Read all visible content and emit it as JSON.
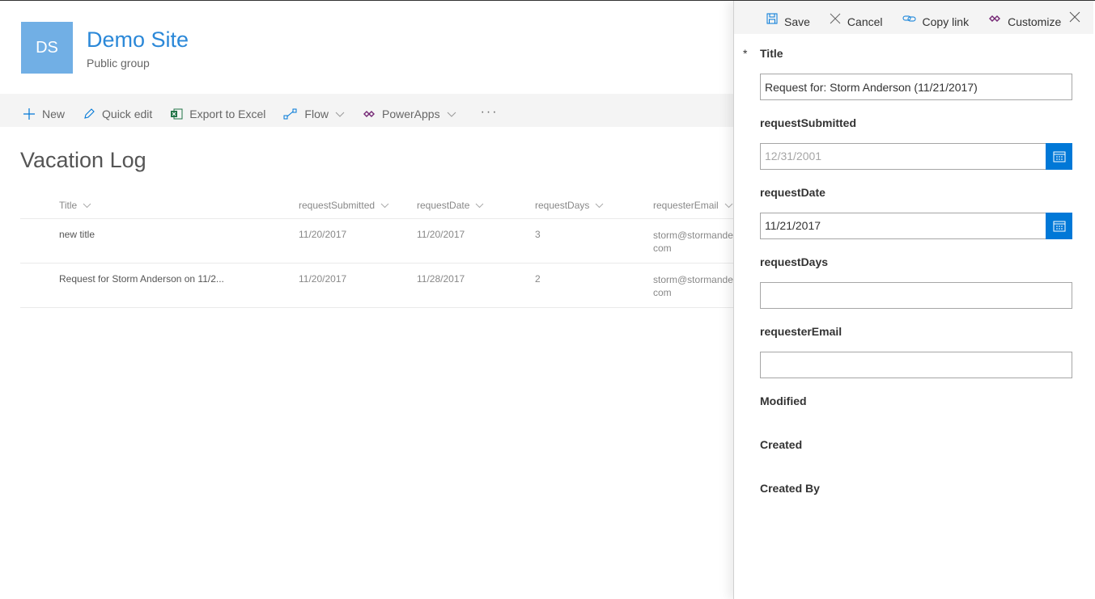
{
  "site": {
    "logo_initials": "DS",
    "title": "Demo Site",
    "subtitle": "Public group"
  },
  "commands": {
    "new": "New",
    "quick_edit": "Quick edit",
    "export": "Export to Excel",
    "flow": "Flow",
    "powerapps": "PowerApps",
    "more": "···"
  },
  "list": {
    "title": "Vacation Log",
    "columns": [
      "Title",
      "requestSubmitted",
      "requestDate",
      "requestDays",
      "requesterEmail"
    ],
    "rows": [
      {
        "title": "new title",
        "requestSubmitted": "11/20/2017",
        "requestDate": "11/20/2017",
        "requestDays": "3",
        "requesterEmail": "storm@stormande com"
      },
      {
        "title": "Request for Storm Anderson on 11/2...",
        "requestSubmitted": "11/20/2017",
        "requestDate": "11/28/2017",
        "requestDays": "2",
        "requesterEmail": "storm@stormande com"
      }
    ]
  },
  "panel": {
    "commands": {
      "save": "Save",
      "cancel": "Cancel",
      "copy_link": "Copy link",
      "customize": "Customize"
    },
    "fields": {
      "title_label": "Title",
      "required_marker": "*",
      "title_value": "Request for: Storm Anderson (11/21/2017)",
      "requestSubmitted_label": "requestSubmitted",
      "requestSubmitted_placeholder": "12/31/2001",
      "requestDate_label": "requestDate",
      "requestDate_value": "11/21/2017",
      "requestDays_label": "requestDays",
      "requestDays_value": "",
      "requesterEmail_label": "requesterEmail",
      "requesterEmail_value": "",
      "modified_label": "Modified",
      "created_label": "Created",
      "created_by_label": "Created By"
    }
  },
  "colors": {
    "accent": "#0078d7",
    "site_logo": "#71afe5",
    "site_title": "#2b88d8",
    "powerapps": "#742774",
    "excel": "#217346"
  }
}
